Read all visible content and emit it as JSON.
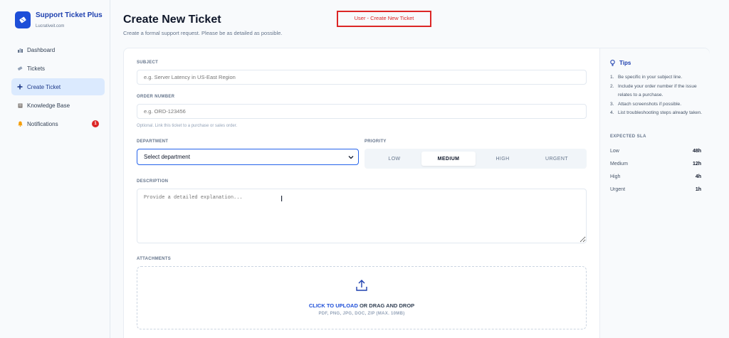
{
  "app": {
    "name": "Support Ticket Plus",
    "subtitle": "Lucrativeit.com"
  },
  "sidebar": {
    "items": [
      {
        "label": "Dashboard",
        "icon": "dashboard-icon"
      },
      {
        "label": "Tickets",
        "icon": "ticket-icon"
      },
      {
        "label": "Create Ticket",
        "icon": "plus-icon",
        "active": true
      },
      {
        "label": "Knowledge Base",
        "icon": "book-icon"
      },
      {
        "label": "Notifications",
        "icon": "bell-icon",
        "badge": "1"
      }
    ]
  },
  "header": {
    "title": "Create New Ticket",
    "subtitle": "Create a formal support request. Please be as detailed as possible.",
    "annotation": "User - Create New Ticket"
  },
  "form": {
    "subject": {
      "label": "SUBJECT",
      "placeholder": "e.g. Server Latency in US-East Region"
    },
    "order": {
      "label": "ORDER NUMBER",
      "placeholder": "e.g. ORD-123456",
      "hint": "Optional. Link this ticket to a purchase or sales order."
    },
    "department": {
      "label": "DEPARTMENT",
      "value": "Select department"
    },
    "priority": {
      "label": "PRIORITY",
      "options": [
        "LOW",
        "MEDIUM",
        "HIGH",
        "URGENT"
      ],
      "selected": "MEDIUM"
    },
    "description": {
      "label": "DESCRIPTION",
      "placeholder": "Provide a detailed explanation..."
    },
    "attachments": {
      "label": "ATTACHMENTS",
      "link": "CLICK TO UPLOAD",
      "rest": " OR DRAG AND DROP",
      "types": "PDF, PNG, JPG, DOC, ZIP (MAX. 10MB)"
    }
  },
  "tips": {
    "title": "Tips",
    "items": [
      "Be specific in your subject line.",
      "Include your order number if the issue relates to a purchase.",
      "Attach screenshots if possible.",
      "List troubleshooting steps already taken."
    ]
  },
  "sla": {
    "title": "EXPECTED SLA",
    "rows": [
      {
        "level": "Low",
        "time": "48h"
      },
      {
        "level": "Medium",
        "time": "12h"
      },
      {
        "level": "High",
        "time": "4h"
      },
      {
        "level": "Urgent",
        "time": "1h"
      }
    ]
  },
  "colors": {
    "accent": "#1d4ed8",
    "active_nav_bg": "#dbeafe",
    "badge": "#dc2626"
  }
}
